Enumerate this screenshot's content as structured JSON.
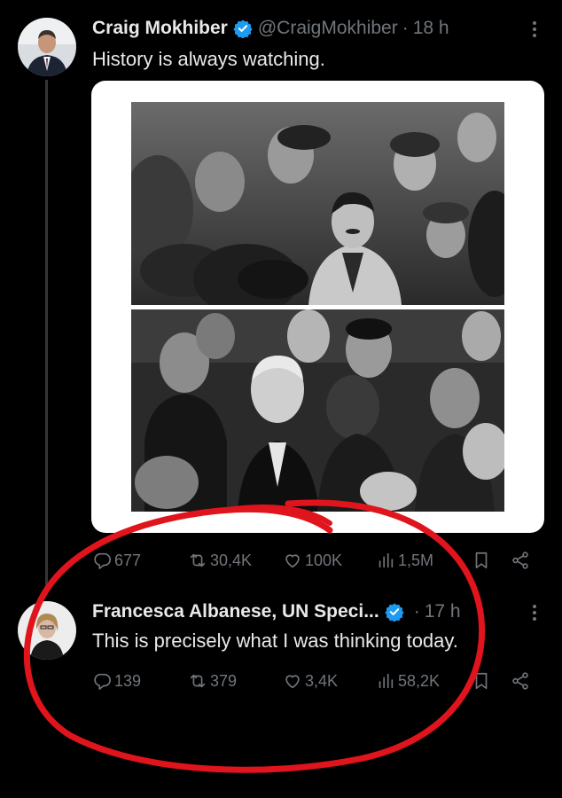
{
  "tweet1": {
    "display_name": "Craig Mokhiber",
    "handle": "@CraigMokhiber",
    "separator": "·",
    "time": "18 h",
    "text": "History is always watching.",
    "stats": {
      "replies": "677",
      "retweets": "30,4K",
      "likes": "100K",
      "views": "1,5M"
    }
  },
  "tweet2": {
    "display_name": "Francesca Albanese, UN Speci...",
    "separator": "·",
    "time": "17 h",
    "text": "This is precisely what I was thinking today.",
    "stats": {
      "replies": "139",
      "retweets": "379",
      "likes": "3,4K",
      "views": "58,2K"
    }
  },
  "icons": {
    "verified": "verified-badge-icon",
    "more": "more-options-icon",
    "reply": "reply-icon",
    "retweet": "retweet-icon",
    "like": "heart-icon",
    "views": "views-bar-chart-icon",
    "bookmark": "bookmark-icon",
    "share": "share-icon"
  },
  "colors": {
    "background": "#000000",
    "text": "#e7e9ea",
    "secondary": "#71767b",
    "verified": "#1d9bf0",
    "annotation": "#e0141c"
  }
}
